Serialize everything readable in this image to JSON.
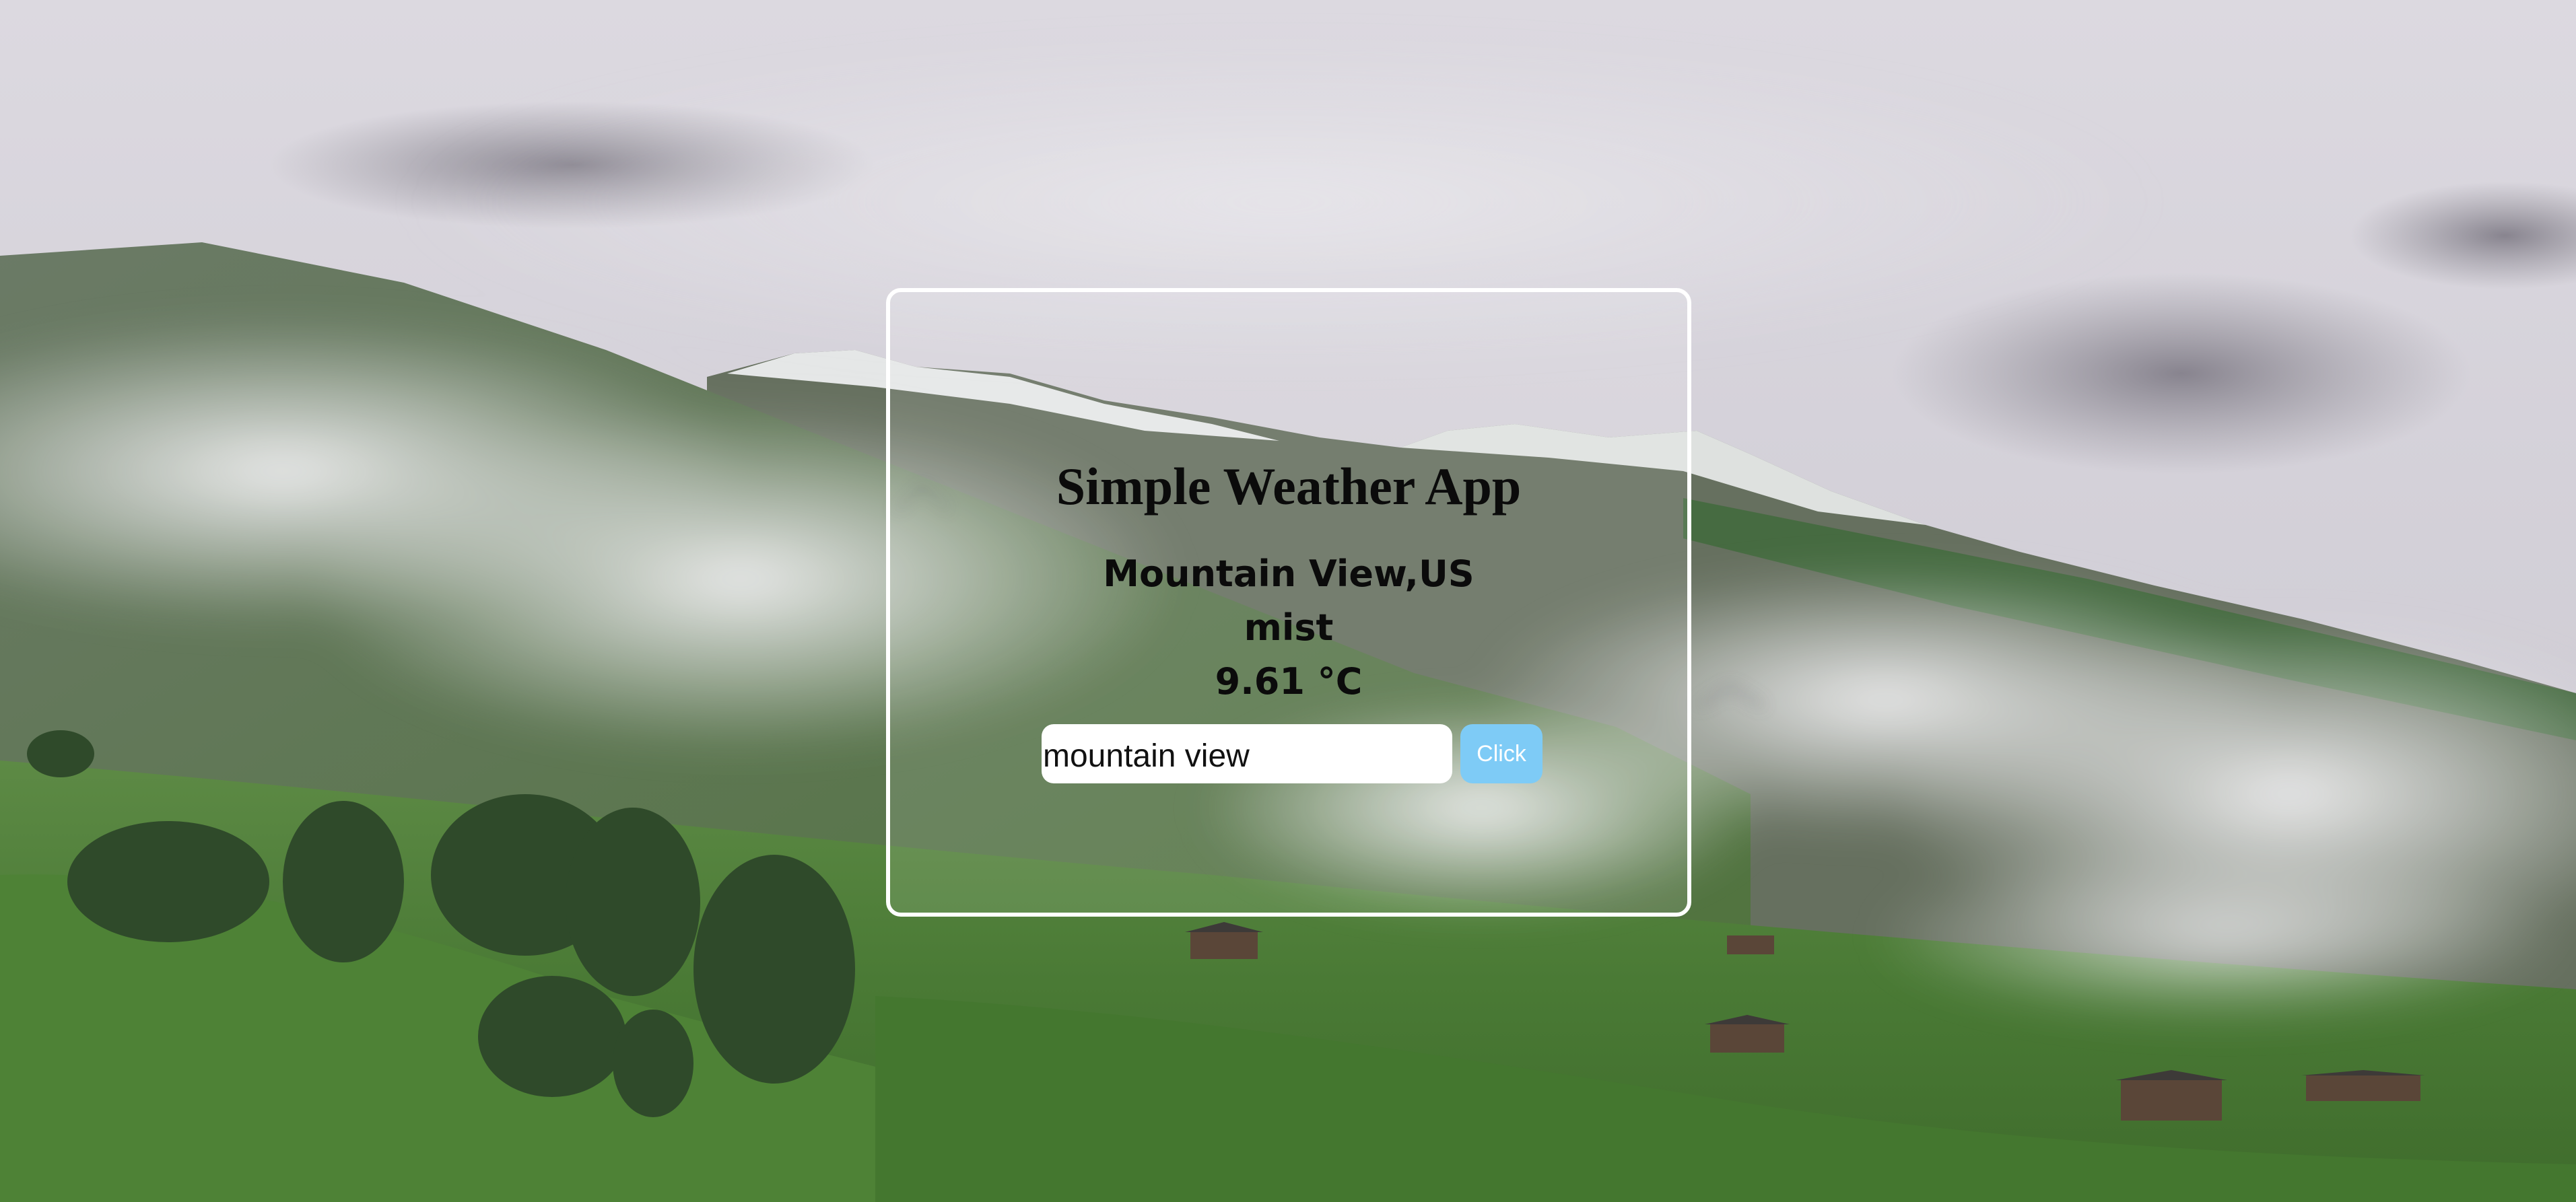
{
  "app": {
    "title": "Simple Weather App"
  },
  "weather": {
    "location": "Mountain View,US",
    "condition": "mist",
    "temperature": "9.61 °C"
  },
  "search": {
    "value": "mountain view",
    "button_label": "Click"
  },
  "colors": {
    "card_border": "#ffffff",
    "button_background": "#7ecbf6",
    "button_text": "#ffffff",
    "text": "#0b0b0b"
  },
  "background": {
    "icon": "mountain-landscape-photo"
  }
}
